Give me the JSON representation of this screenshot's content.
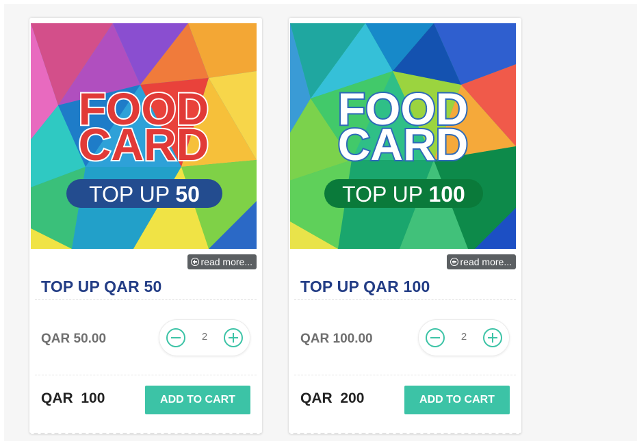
{
  "products": [
    {
      "art": {
        "logo_line1": "FOOD",
        "logo_line2": "CARD",
        "pill_prefix": "TOP UP",
        "pill_amount": "50",
        "colors": {
          "logo_fill": "#e13a37",
          "logo_outline": "#ffffff",
          "pill": "#234c8f"
        }
      },
      "read_more": "read more...",
      "title": "TOP UP QAR 50",
      "price": "QAR 50.00",
      "quantity": "2",
      "total": "QAR  100",
      "add_to_cart": "ADD TO CART"
    },
    {
      "art": {
        "logo_line1": "FOOD",
        "logo_line2": "CARD",
        "pill_prefix": "TOP UP",
        "pill_amount": "100",
        "colors": {
          "logo_fill": "#ffffff",
          "logo_outline": "#2d6ab8",
          "pill": "#0a7a3a"
        }
      },
      "read_more": "read more...",
      "title": "TOP UP QAR 100",
      "price": "QAR 100.00",
      "quantity": "2",
      "total": "QAR  200",
      "add_to_cart": "ADD TO CART"
    }
  ],
  "icons": {
    "read_more": "plus-circle-icon",
    "decrease": "minus-circle-icon",
    "increase": "plus-circle-icon"
  },
  "colors": {
    "accent": "#3cc3a6",
    "title": "#233d85",
    "read_more_bg": "#5b5f62"
  }
}
